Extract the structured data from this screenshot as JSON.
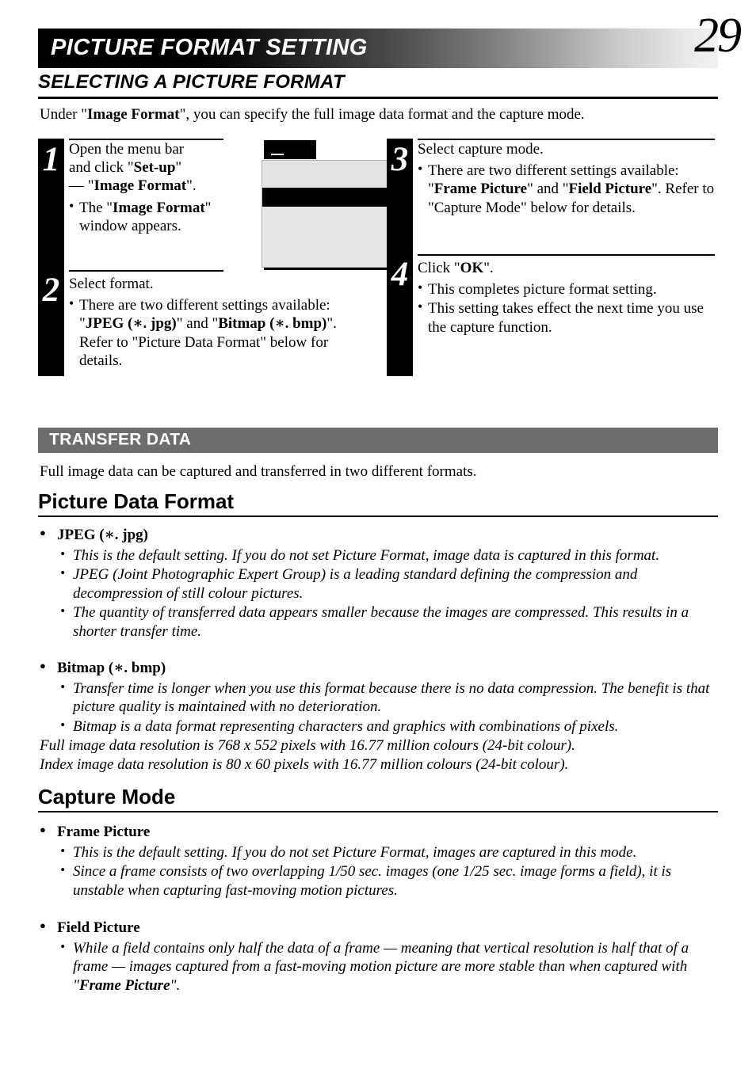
{
  "header": {
    "title": "PICTURE FORMAT SETTING",
    "page_number": "29"
  },
  "section": {
    "title": "SELECTING A PICTURE FORMAT",
    "intro_prefix": "Under \"",
    "intro_bold": "Image Format",
    "intro_suffix": "\", you can specify the full image data format and the capture mode."
  },
  "steps": [
    {
      "number": "1",
      "line1": "Open the menu bar",
      "line2_prefix": "and click \"",
      "line2_bold": "Set-up",
      "line2_suffix": "\"",
      "line3_prefix": "— \"",
      "line3_bold": "Image Format",
      "line3_suffix": "\".",
      "bullet_prefix": "The \"",
      "bullet_bold": "Image Format",
      "bullet_suffix": "\" window appears."
    },
    {
      "number": "2",
      "title": "Select format.",
      "bullet_prefix": "There are two different settings available: \"",
      "bullet_bold1": "JPEG (∗. jpg)",
      "bullet_mid": "\" and \"",
      "bullet_bold2": "Bitmap (∗. bmp)",
      "bullet_suffix": "\".  Refer to \"Picture Data Format\" below for details."
    },
    {
      "number": "3",
      "title": "Select capture mode.",
      "bullet_prefix": "There are two different settings available: \"",
      "bullet_bold1": "Frame Picture",
      "bullet_mid": "\" and \"",
      "bullet_bold2": "Field Picture",
      "bullet_suffix": "\".  Refer to \"Capture Mode\" below for details."
    },
    {
      "number": "4",
      "title_prefix": "Click \"",
      "title_bold": "OK",
      "title_suffix": "\".",
      "bullet1": "This completes picture format setting.",
      "bullet2": "This setting takes effect the next time you use the capture function."
    }
  ],
  "menu_graphic": {
    "menu_bar_item_label": "",
    "submenu_row_label": "",
    "selected_row_label": "",
    "arrow_icon": "submenu-arrow-icon"
  },
  "transfer_data": {
    "band_label": "TRANSFER DATA",
    "caption": "Full image data can be captured and transferred in two different formats."
  },
  "picture_data_format": {
    "heading": "Picture Data Format",
    "jpeg": {
      "label": "JPEG (∗. jpg)",
      "items": [
        "This is the default setting. If you do not set Picture Format, image data is captured in this format.",
        "JPEG (Joint Photographic Expert Group) is a leading standard defining the compression and decompression of still colour pictures.",
        "The quantity of transferred data appears smaller because the images are compressed. This results in a shorter transfer time."
      ]
    },
    "bitmap": {
      "label": "Bitmap (∗. bmp)",
      "items": [
        "Transfer time is longer when you use this format because there is no data compression. The benefit is that picture quality is maintained with no deterioration.",
        "Bitmap is a data format representing characters and graphics with combinations of pixels."
      ],
      "notes": [
        "Full image data resolution is 768 x 552 pixels with 16.77 million colours (24-bit colour).",
        "Index image data resolution is 80 x 60 pixels with 16.77 million colours (24-bit colour)."
      ]
    }
  },
  "capture_mode": {
    "heading": "Capture Mode",
    "frame_picture": {
      "label": "Frame Picture",
      "items": [
        "This is the default setting. If you do not set Picture Format, images are captured in this mode.",
        "Since a frame consists of two overlapping 1/50 sec. images (one 1/25 sec. image forms a field), it is unstable when capturing fast-moving motion pictures."
      ]
    },
    "field_picture": {
      "label": "Field Picture",
      "item_prefix": "While a field contains only half the data of a frame — meaning that vertical resolution is half that of a  frame — images captured from a fast-moving motion picture are more stable than when captured with \"",
      "item_bold": "Frame Picture",
      "item_suffix": "\"."
    }
  },
  "colors": {
    "band_grey": "#6d6d6d",
    "ink": "#000000",
    "dialog_face": "#e6e6e6"
  }
}
